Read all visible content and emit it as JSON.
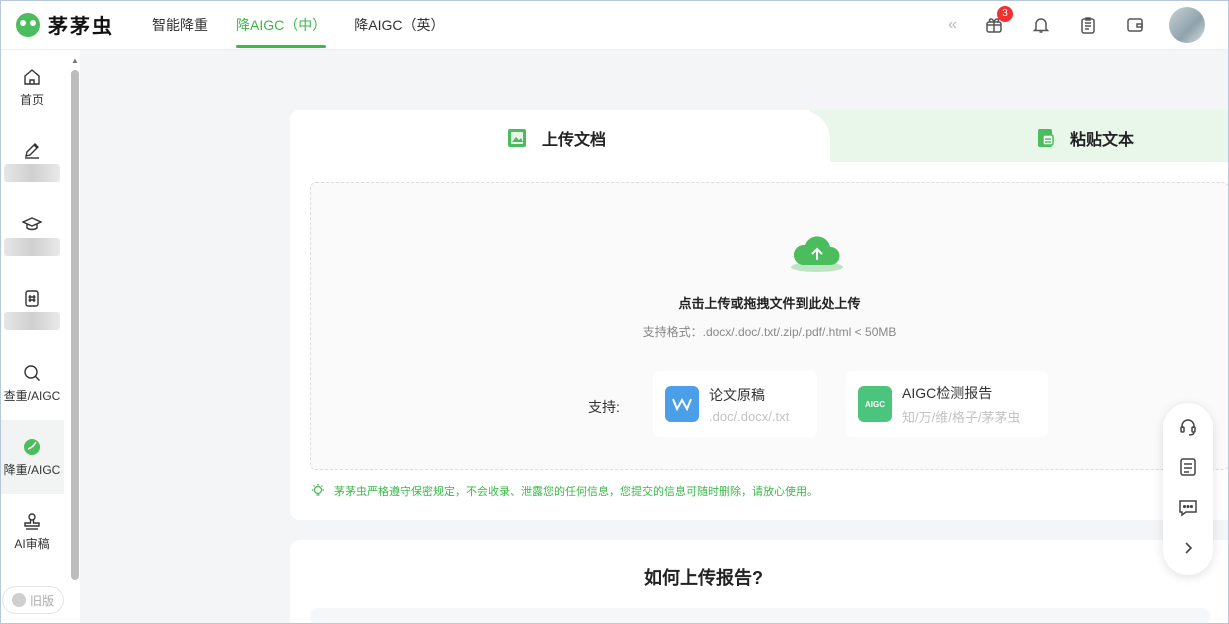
{
  "brand": {
    "name": "茅茅虫",
    "color": "#3cb94a"
  },
  "nav": {
    "items": [
      {
        "label": "智能降重",
        "active": false
      },
      {
        "label": "降AIGC（中）",
        "active": true
      },
      {
        "label": "降AIGC（英）",
        "active": false
      }
    ]
  },
  "header": {
    "collapse_glyph": "«",
    "cart_badge": "3",
    "icons": [
      "gift-icon",
      "bell-icon",
      "clipboard-icon",
      "wallet-icon"
    ]
  },
  "sidebar": {
    "items": [
      {
        "label": "首页",
        "icon": "home-icon"
      },
      {
        "label": "",
        "icon": "pen-icon",
        "blurred": true
      },
      {
        "label": "",
        "icon": "graduation-cap-icon",
        "blurred": true
      },
      {
        "label": "",
        "icon": "hash-doc-icon",
        "blurred": true
      },
      {
        "label": "查重/AIGC",
        "icon": "search-icon"
      },
      {
        "label": "降重/AIGC",
        "icon": "leaf-icon",
        "active": true
      },
      {
        "label": "AI审稿",
        "icon": "stamp-icon"
      }
    ],
    "old_version": "旧版"
  },
  "upload": {
    "tab_upload": "上传文档",
    "tab_paste": "粘贴文本",
    "title": "点击上传或拖拽文件到此处上传",
    "formats": "支持格式：.docx/.doc/.txt/.zip/.pdf/.html < 50MB",
    "support_label": "支持:",
    "cards": [
      {
        "title": "论文原稿",
        "sub": ".doc/.docx/.txt",
        "icon_text": "W",
        "color": "#4a9fe8"
      },
      {
        "title": "AIGC检测报告",
        "sub": "知/万/维/格子/茅茅虫",
        "icon_text": "AIGC",
        "color": "#4bc47d"
      }
    ],
    "notice": "茅茅虫严格遵守保密规定，不会收录、泄露您的任何信息，您提交的信息可随时删除，请放心使用。"
  },
  "section2": {
    "title": "如何上传报告?"
  },
  "float_bar": {
    "icons": [
      "headset-icon",
      "document-icon",
      "chat-icon",
      "chevron-right-icon"
    ]
  }
}
